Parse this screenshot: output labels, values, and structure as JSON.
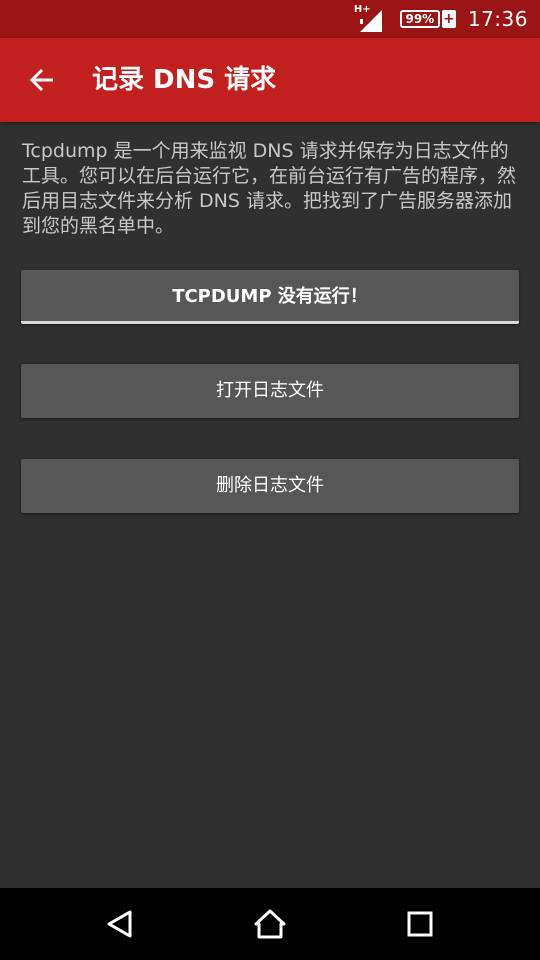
{
  "status_bar": {
    "network_label": "H+",
    "battery_percent": "99%",
    "battery_charging_symbol": "+",
    "time": "17:36",
    "background_color": "#9b1414"
  },
  "app_bar": {
    "title": "记录 DNS 请求",
    "back_icon": "arrow-left-icon",
    "background_color": "#c21f1f"
  },
  "description": "Tcpdump 是一个用来监视 DNS 请求并保存为日志文件的工具。您可以在后台运行它，在前台运行有广告的程序，然后用目志文件来分析 DNS 请求。把找到了广告服务器添加到您的黑名单中。",
  "buttons": {
    "tcpdump_status": "TCPDUMP 没有运行！",
    "open_log": "打开日志文件",
    "delete_log": "删除日志文件"
  },
  "nav_bar": {
    "back_icon": "triangle-back-icon",
    "home_icon": "home-icon",
    "recents_icon": "square-recents-icon"
  }
}
